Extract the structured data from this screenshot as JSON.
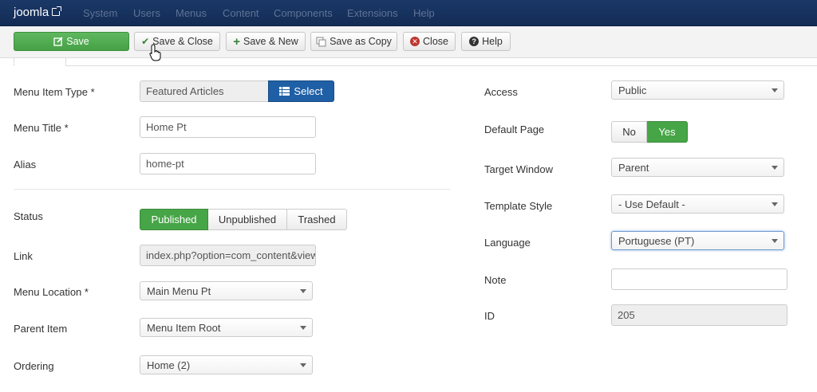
{
  "navbar": {
    "brand": "joomla",
    "menu": [
      "System",
      "Users",
      "Menus",
      "Content",
      "Components",
      "Extensions",
      "Help"
    ]
  },
  "toolbar": {
    "save": "Save",
    "save_close": "Save & Close",
    "save_new": "Save & New",
    "save_copy": "Save as Copy",
    "close": "Close",
    "help": "Help"
  },
  "form_left": {
    "menu_item_type": {
      "label": "Menu Item Type *",
      "value": "Featured Articles",
      "button": "Select"
    },
    "menu_title": {
      "label": "Menu Title *",
      "value": "Home Pt"
    },
    "alias": {
      "label": "Alias",
      "value": "home-pt"
    },
    "status": {
      "label": "Status",
      "options": [
        "Published",
        "Unpublished",
        "Trashed"
      ],
      "selected": "Published"
    },
    "link": {
      "label": "Link",
      "value": "index.php?option=com_content&view=featured"
    },
    "menu_location": {
      "label": "Menu Location *",
      "value": "Main Menu Pt"
    },
    "parent_item": {
      "label": "Parent Item",
      "value": "Menu Item Root"
    },
    "ordering": {
      "label": "Ordering",
      "value": "Home (2)"
    }
  },
  "form_right": {
    "access": {
      "label": "Access",
      "value": "Public"
    },
    "default_page": {
      "label": "Default Page",
      "options": [
        "No",
        "Yes"
      ],
      "selected": "Yes"
    },
    "target_window": {
      "label": "Target Window",
      "value": "Parent"
    },
    "template_style": {
      "label": "Template Style",
      "value": "- Use Default -"
    },
    "language": {
      "label": "Language",
      "value": "Portuguese (PT)"
    },
    "note": {
      "label": "Note",
      "value": ""
    },
    "id": {
      "label": "ID",
      "value": "205"
    }
  },
  "colors": {
    "navbar": "#17305c",
    "success": "#46a546",
    "primary": "#1f5fa5"
  }
}
